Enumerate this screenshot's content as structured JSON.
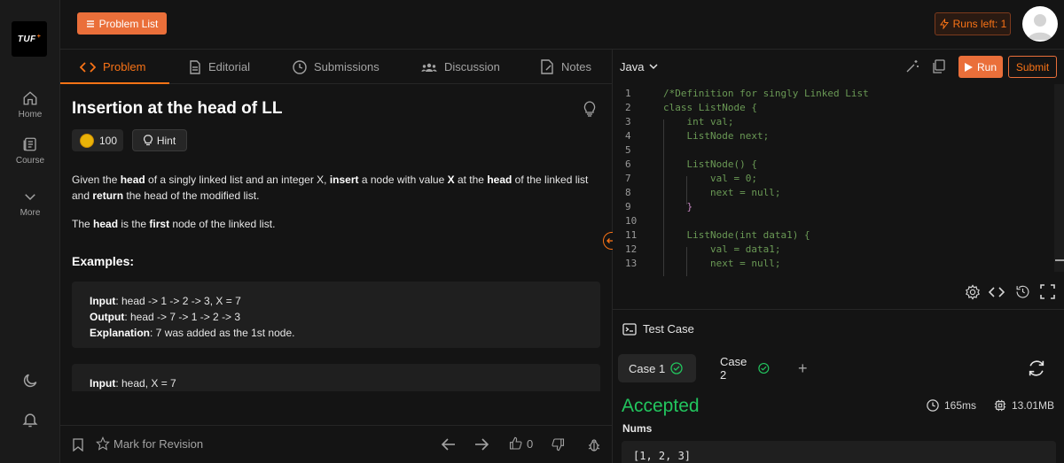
{
  "sidebar": {
    "logo": "TUF",
    "logo_sup": "+",
    "items": [
      {
        "label": "Home",
        "icon": "home-icon"
      },
      {
        "label": "Course",
        "icon": "course-icon"
      },
      {
        "label": "More",
        "icon": "chevron-down-icon"
      }
    ]
  },
  "topbar": {
    "problem_list_label": "Problem List",
    "runs_left_label": "Runs left: 1"
  },
  "tabs": [
    {
      "label": "Problem",
      "icon": "code-brackets-icon"
    },
    {
      "label": "Editorial",
      "icon": "document-icon"
    },
    {
      "label": "Submissions",
      "icon": "clock-icon"
    },
    {
      "label": "Discussion",
      "icon": "people-icon"
    },
    {
      "label": "Notes",
      "icon": "note-icon"
    }
  ],
  "problem": {
    "title": "Insertion at the head of LL",
    "coins": "100",
    "hint_label": "Hint",
    "desc": {
      "p1": "Given the ",
      "b1": "head",
      "p2": " of a singly linked list and an integer X, ",
      "b2": "insert",
      "p3": " a node with value ",
      "b3": "X",
      "p4": " at the ",
      "b4": "head",
      "p5": " of the linked list and ",
      "b5": "return",
      "p6": " the head of the modified list."
    },
    "desc2": {
      "p1": "The ",
      "b1": "head",
      "p2": " is the ",
      "b2": "first",
      "p3": " node of the linked list."
    },
    "examples_heading": "Examples:",
    "example1": {
      "input_label": "Input",
      "input": ": head -> 1 -> 2 -> 3, X = 7",
      "output_label": "Output",
      "output": ": head -> 7 -> 1 -> 2 -> 3",
      "explanation_label": "Explanation",
      "explanation": ": 7 was added as the 1st node."
    },
    "example2": {
      "input_label": "Input",
      "input": ": head, X = 7"
    }
  },
  "bottom_bar": {
    "mark_label": "Mark for Revision",
    "like_count": "0"
  },
  "editor": {
    "language": "Java",
    "run_label": "Run",
    "submit_label": "Submit",
    "lines": [
      {
        "n": "1",
        "text": "/*Definition for singly Linked List"
      },
      {
        "n": "2",
        "text": "class ListNode {"
      },
      {
        "n": "3",
        "text": "    int val;"
      },
      {
        "n": "4",
        "text": "    ListNode next;"
      },
      {
        "n": "5",
        "text": ""
      },
      {
        "n": "6",
        "text": "    ListNode() {"
      },
      {
        "n": "7",
        "text": "        val = 0;"
      },
      {
        "n": "8",
        "text": "        next = null;"
      },
      {
        "n": "9",
        "text": "    }"
      },
      {
        "n": "10",
        "text": ""
      },
      {
        "n": "11",
        "text": "    ListNode(int data1) {"
      },
      {
        "n": "12",
        "text": "        val = data1;"
      },
      {
        "n": "13",
        "text": "        next = null;"
      }
    ]
  },
  "testcase": {
    "header": "Test Case",
    "case1": "Case 1",
    "case2": "Case 2",
    "add": "+",
    "status": "Accepted",
    "runtime": "165ms",
    "memory": "13.01MB",
    "nums_label": "Nums",
    "nums_value": "[1, 2, 3]"
  },
  "colors": {
    "accent": "#ea6f3a",
    "accepted": "#22c55e",
    "code_comment": "#6a9955",
    "code_keyword": "#c586c0"
  }
}
